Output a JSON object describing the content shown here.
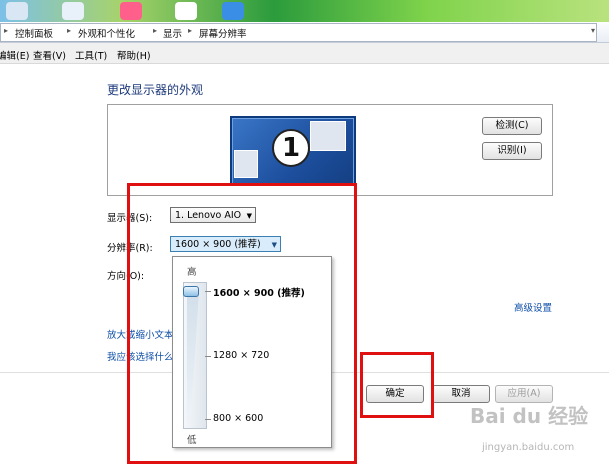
{
  "breadcrumb": [
    "控制面板",
    "外观和个性化",
    "显示",
    "屏幕分辨率"
  ],
  "menu": [
    "编辑(E)",
    "查看(V)",
    "工具(T)",
    "帮助(H)"
  ],
  "page_title": "更改显示器的外观",
  "monitor_number": "1",
  "buttons": {
    "detect": "检测(C)",
    "identify": "识别(I)",
    "ok": "确定",
    "cancel": "取消",
    "apply": "应用(A)"
  },
  "display": {
    "label": "显示器(S):",
    "value": "1. Lenovo AIO"
  },
  "resolution": {
    "label": "分辨率(R):",
    "value": "1600 × 900 (推荐)",
    "high_label": "高",
    "low_label": "低",
    "options": [
      "1600 × 900 (推荐)",
      "1280 × 720",
      "800 × 600"
    ],
    "selected_index": 0
  },
  "orientation": {
    "label": "方向(O):"
  },
  "links": {
    "advanced": "高级设置",
    "text_size": "放大或缩小文本",
    "which_settings": "我应该选择什么"
  },
  "watermark": {
    "brand": "Bai du 经验",
    "url": "jingyan.baidu.com"
  },
  "colors": {
    "annotation": "#e01010",
    "link": "#0f4fa8",
    "title": "#1e3a7b",
    "monitor": "#1f56a8"
  }
}
